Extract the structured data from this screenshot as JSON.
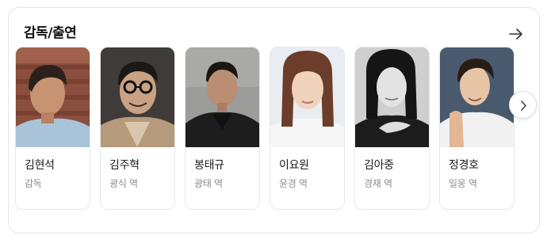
{
  "section": {
    "title": "감독/출연"
  },
  "people": [
    {
      "name": "김현석",
      "role": "감독"
    },
    {
      "name": "김주혁",
      "role": "광식 역"
    },
    {
      "name": "봉태규",
      "role": "광태 역"
    },
    {
      "name": "이요원",
      "role": "윤경 역"
    },
    {
      "name": "김아중",
      "role": "경재 역"
    },
    {
      "name": "정경호",
      "role": "일웅 역"
    }
  ],
  "icons": {
    "more": "arrow-right-icon",
    "next": "chevron-right-icon"
  },
  "colors": {
    "border": "#e3e5e8",
    "name_text": "#1a1a1a",
    "role_text": "#8a8d92"
  }
}
